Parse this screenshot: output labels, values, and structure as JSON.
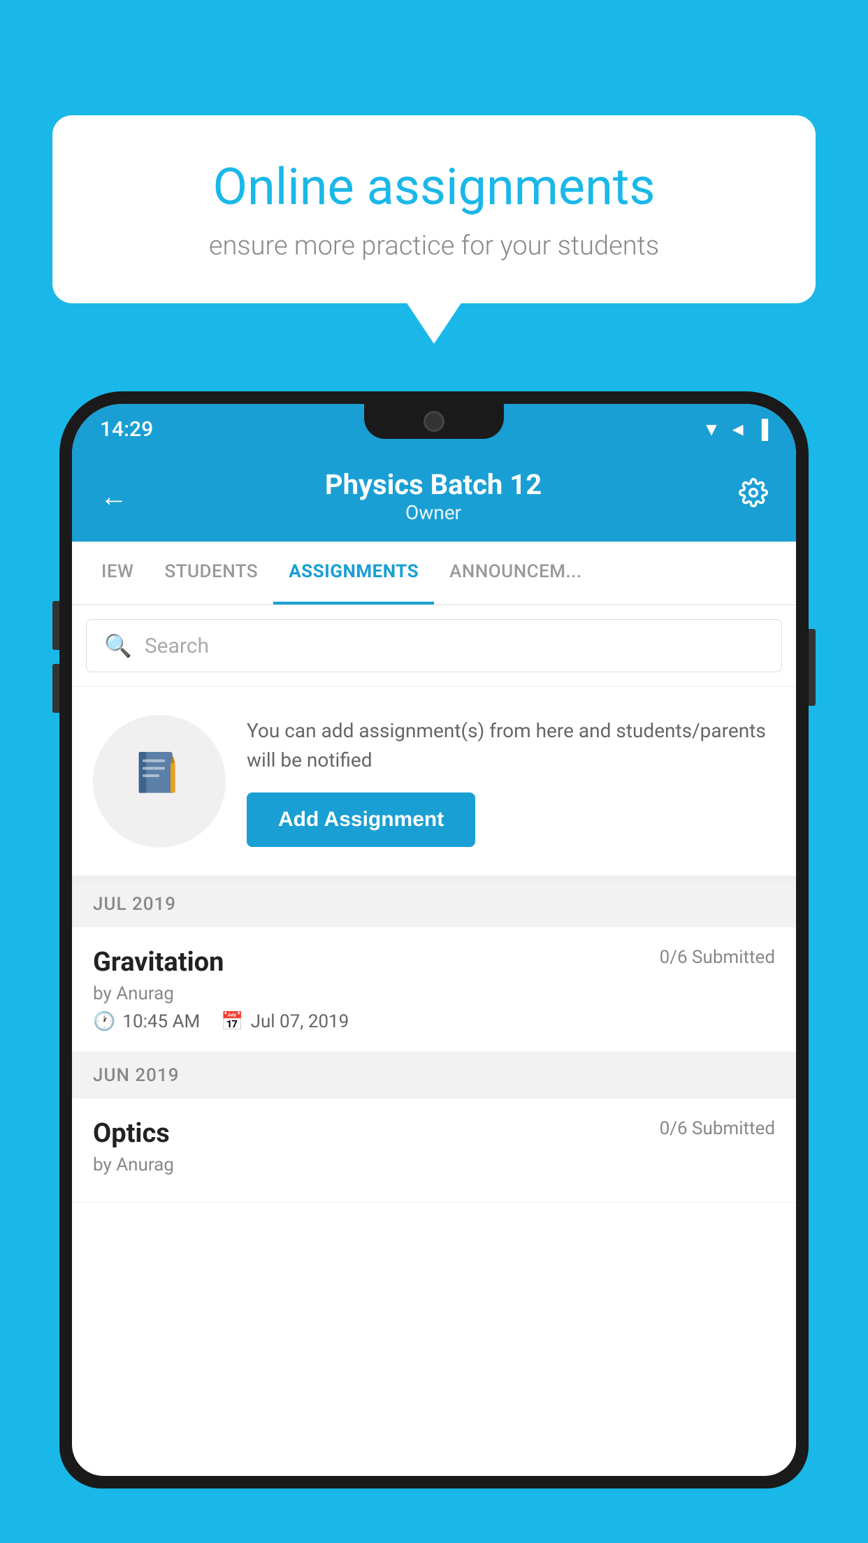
{
  "background": {
    "color": "#1ab8e8"
  },
  "speech_bubble": {
    "title": "Online assignments",
    "subtitle": "ensure more practice for your students"
  },
  "phone": {
    "status_bar": {
      "time": "14:29",
      "icons": [
        "wifi",
        "signal",
        "battery"
      ]
    },
    "header": {
      "title": "Physics Batch 12",
      "subtitle": "Owner",
      "back_label": "←",
      "settings_label": "⚙"
    },
    "tabs": [
      {
        "label": "IEW",
        "active": false
      },
      {
        "label": "STUDENTS",
        "active": false
      },
      {
        "label": "ASSIGNMENTS",
        "active": true
      },
      {
        "label": "ANNOUNCEM...",
        "active": false
      }
    ],
    "search": {
      "placeholder": "Search"
    },
    "add_assignment_section": {
      "description": "You can add assignment(s) from here and students/parents will be notified",
      "button_label": "Add Assignment"
    },
    "months": [
      {
        "label": "JUL 2019",
        "assignments": [
          {
            "title": "Gravitation",
            "submitted": "0/6 Submitted",
            "by": "by Anurag",
            "time": "10:45 AM",
            "date": "Jul 07, 2019"
          }
        ]
      },
      {
        "label": "JUN 2019",
        "assignments": [
          {
            "title": "Optics",
            "submitted": "0/6 Submitted",
            "by": "by Anurag",
            "time": "",
            "date": ""
          }
        ]
      }
    ]
  }
}
